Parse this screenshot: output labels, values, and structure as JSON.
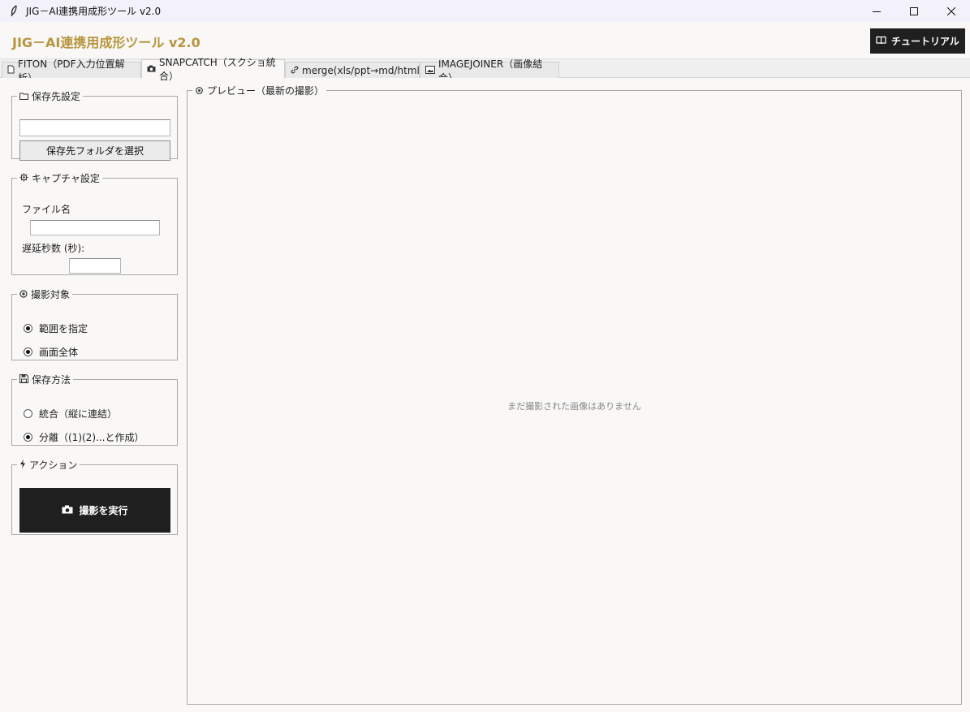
{
  "window": {
    "title": "JIG－AI連携用成形ツール v2.0",
    "controls": [
      "minimize-icon",
      "maximize-icon",
      "close-icon"
    ]
  },
  "header": {
    "app_title": "JIG－AI連携用成形ツール v2.0",
    "tutorial_button": "チュートリアル",
    "accent_color": "#b8953e"
  },
  "tabs": [
    {
      "label": "FITON（PDF入力位置解析）",
      "icon": "document-icon",
      "active": false
    },
    {
      "label": "SNAPCATCH（スクショ統合）",
      "icon": "camera-icon",
      "active": true
    },
    {
      "label": "merge(xls/ppt→md/html)",
      "icon": "link-icon",
      "active": false
    },
    {
      "label": "IMAGEJOINER（画像結合）",
      "icon": "image-icon",
      "active": false
    }
  ],
  "save_location": {
    "legend": "保存先設定",
    "path_value": "",
    "select_button": "保存先フォルダを選択"
  },
  "capture_settings": {
    "legend": "キャプチャ設定",
    "filename_label": "ファイル名",
    "filename_value": "",
    "delay_label": "遅延秒数 (秒):",
    "delay_value": ""
  },
  "target": {
    "legend": "撮影対象",
    "options": [
      {
        "label": "範囲を指定",
        "selected": true
      },
      {
        "label": "画面全体",
        "selected": true
      }
    ]
  },
  "save_method": {
    "legend": "保存方法",
    "options": [
      {
        "label": "統合（縦に連結）",
        "selected": false
      },
      {
        "label": "分離（(1)(2)...と作成）",
        "selected": true
      }
    ]
  },
  "action": {
    "legend": "アクション",
    "shoot_button": "撮影を実行"
  },
  "preview": {
    "legend": "プレビュー（最新の撮影）",
    "empty_message": "まだ撮影された画像はありません"
  }
}
